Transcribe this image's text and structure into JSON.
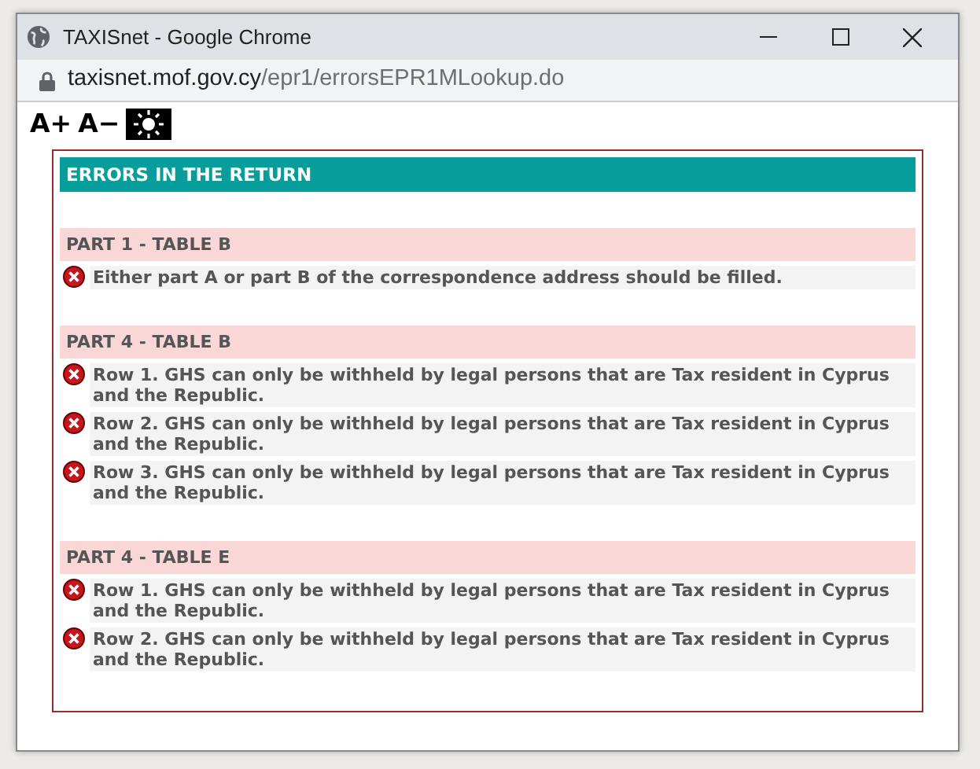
{
  "window": {
    "title": "TAXISnet - Google Chrome"
  },
  "address_bar": {
    "host": "taxisnet.mof.gov.cy",
    "path": "/epr1/errorsEPR1MLookup.do"
  },
  "font_controls": [
    "A+",
    "A−"
  ],
  "panel": {
    "title": "ERRORS IN THE RETURN",
    "sections": [
      {
        "heading": "PART 1 - TABLE B",
        "errors": [
          "Either part A or part B of the correspondence address should be filled."
        ]
      },
      {
        "heading": "PART 4 - TABLE B",
        "errors": [
          "Row 1. GHS can only be withheld by legal persons that are Tax resident in Cyprus and the Republic.",
          "Row 2. GHS can only be withheld by legal persons that are Tax resident in Cyprus and the Republic.",
          "Row 3. GHS can only be withheld by legal persons that are Tax resident in Cyprus and the Republic."
        ]
      },
      {
        "heading": "PART 4 - TABLE E",
        "errors": [
          "Row 1. GHS can only be withheld by legal persons that are Tax resident in Cyprus and the Republic.",
          "Row 2. GHS can only be withheld by legal persons that are Tax resident in Cyprus and the Republic."
        ]
      }
    ]
  }
}
